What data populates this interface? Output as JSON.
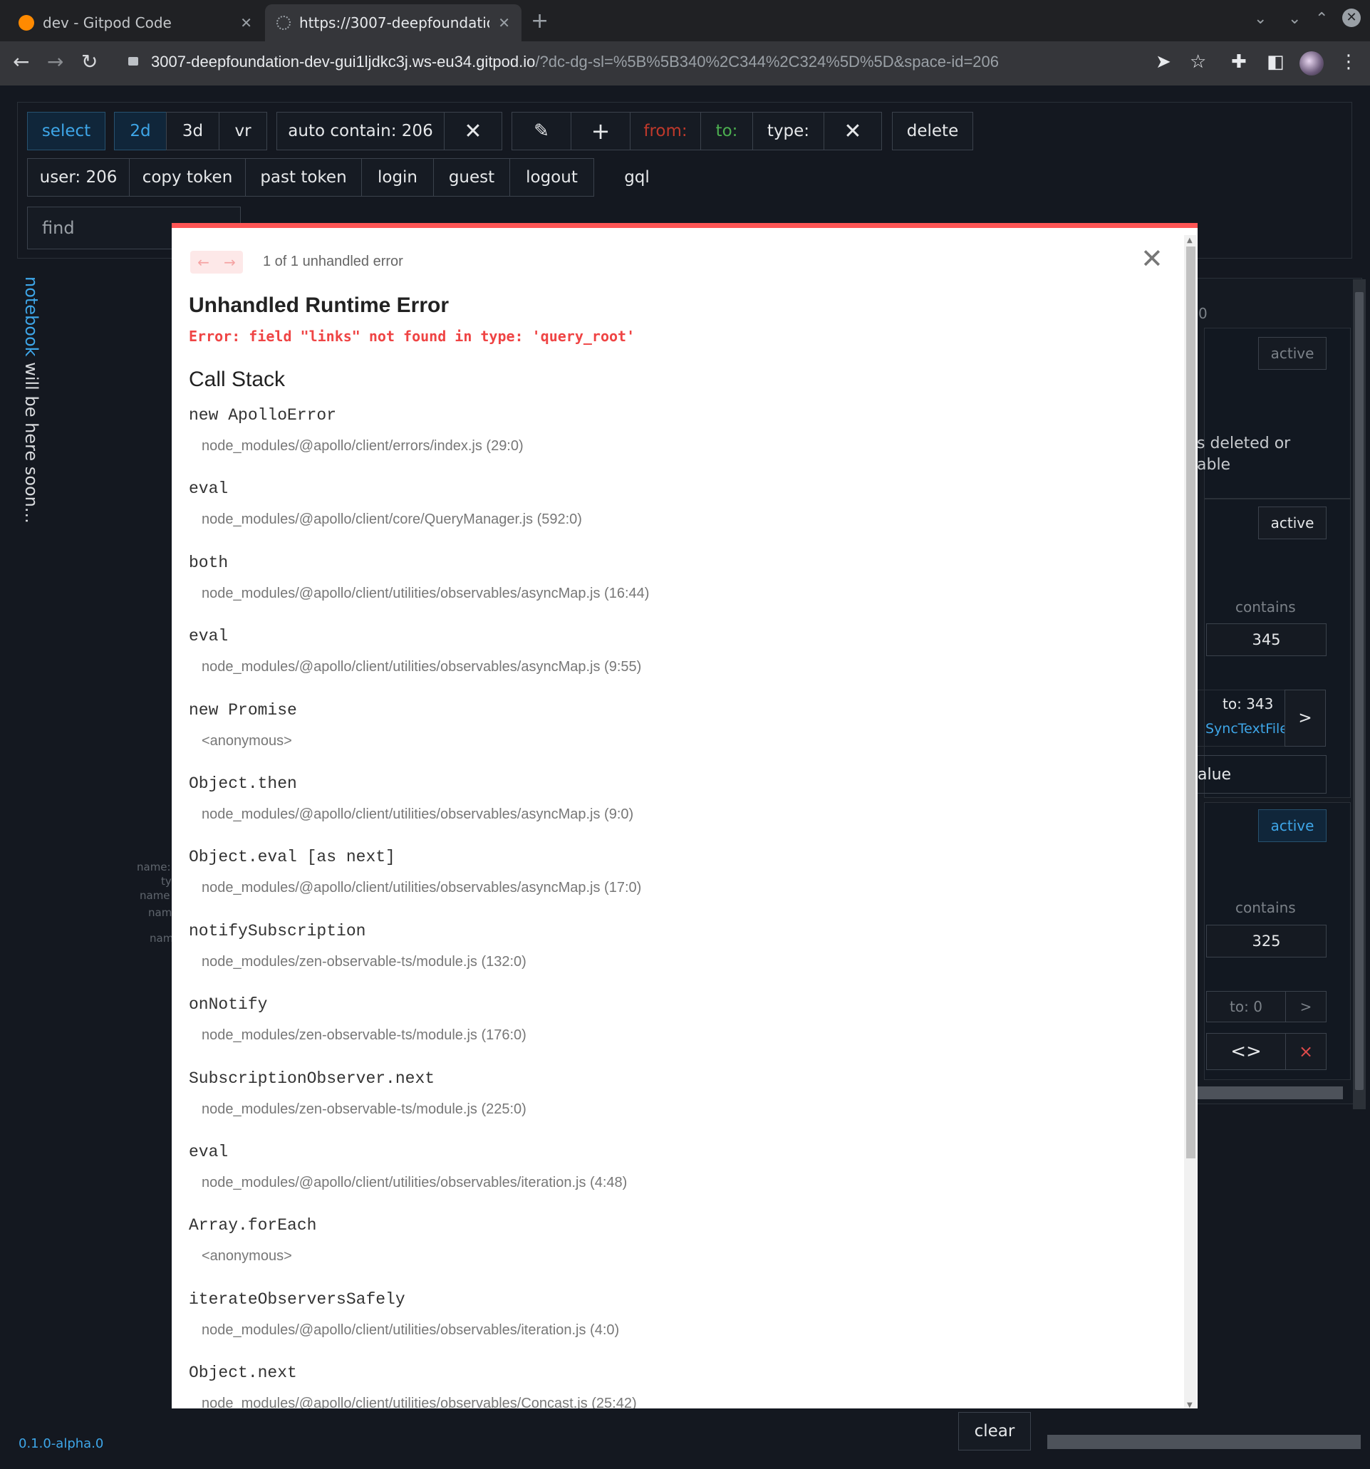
{
  "browser": {
    "tabs": [
      {
        "title": "dev - Gitpod Code",
        "active": false
      },
      {
        "title": "https://3007-deepfoundatior",
        "active": true
      }
    ],
    "url_host": "3007-deepfoundation-dev-gui1ljdkc3j.ws-eu34.gitpod.io",
    "url_path": "/?dc-dg-sl=%5B%5B340%2C344%2C324%5D%5D&space-id=206"
  },
  "toolbar_row1": {
    "select": "select",
    "mode_2d": "2d",
    "mode_3d": "3d",
    "mode_vr": "vr",
    "auto_contain": "auto contain: 206",
    "from": "from:",
    "to": "to:",
    "type": "type:",
    "delete": "delete"
  },
  "toolbar_row2": {
    "user": "user: 206",
    "copy_token": "copy token",
    "past_token": "past token",
    "login": "login",
    "guest": "guest",
    "logout": "logout",
    "gql": "gql"
  },
  "find_placeholder": "find",
  "notebook_prefix": "notebook",
  "notebook_rest": " will be here soon...",
  "version": "0.1.0-alpha.0",
  "clear": "clear",
  "right_panel": {
    "zero": "0",
    "active1": "active",
    "deleted_text": "s deleted or",
    "able_text": "able",
    "active2": "active",
    "contains1": "contains",
    "value1": "345",
    "to1": "to: 343",
    "sync": "SyncTextFile",
    "arrow1": ">",
    "value_text": "alue",
    "active3": "active",
    "contains2": "contains",
    "value2": "325",
    "to2": "to: 0",
    "arrow2": ">",
    "code": "<>",
    "x": "×"
  },
  "behind_labels": [
    "name:",
    "ty",
    "name",
    "nam",
    "nam"
  ],
  "error_overlay": {
    "count": "1 of 1 unhandled error",
    "title": "Unhandled Runtime Error",
    "message": "Error: field \"links\" not found in type: 'query_root'",
    "call_stack": "Call Stack",
    "frames": [
      {
        "fn": "new ApolloError",
        "loc": "node_modules/@apollo/client/errors/index.js (29:0)"
      },
      {
        "fn": "eval",
        "loc": "node_modules/@apollo/client/core/QueryManager.js (592:0)"
      },
      {
        "fn": "both",
        "loc": "node_modules/@apollo/client/utilities/observables/asyncMap.js (16:44)"
      },
      {
        "fn": "eval",
        "loc": "node_modules/@apollo/client/utilities/observables/asyncMap.js (9:55)"
      },
      {
        "fn": "new Promise",
        "loc": "<anonymous>"
      },
      {
        "fn": "Object.then",
        "loc": "node_modules/@apollo/client/utilities/observables/asyncMap.js (9:0)"
      },
      {
        "fn": "Object.eval [as next]",
        "loc": "node_modules/@apollo/client/utilities/observables/asyncMap.js (17:0)"
      },
      {
        "fn": "notifySubscription",
        "loc": "node_modules/zen-observable-ts/module.js (132:0)"
      },
      {
        "fn": "onNotify",
        "loc": "node_modules/zen-observable-ts/module.js (176:0)"
      },
      {
        "fn": "SubscriptionObserver.next",
        "loc": "node_modules/zen-observable-ts/module.js (225:0)"
      },
      {
        "fn": "eval",
        "loc": "node_modules/@apollo/client/utilities/observables/iteration.js (4:48)"
      },
      {
        "fn": "Array.forEach",
        "loc": "<anonymous>"
      },
      {
        "fn": "iterateObserversSafely",
        "loc": "node_modules/@apollo/client/utilities/observables/iteration.js (4:0)"
      },
      {
        "fn": "Object.next",
        "loc": "node_modules/@apollo/client/utilities/observables/Concast.js (25:42)"
      }
    ]
  },
  "colors": {
    "accent_blue": "#3ea6e8",
    "error_red": "#ef4444",
    "overlay_bar": "#ff5555"
  }
}
